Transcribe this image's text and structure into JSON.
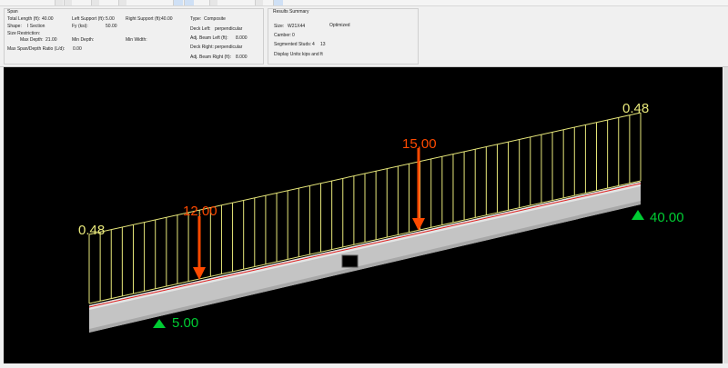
{
  "span": {
    "title": "Span",
    "total_length_label": "Total Length (ft):",
    "total_length": "40.00",
    "shape_label": "Shape:",
    "shape": "I Section",
    "size_restriction_label": "Size Restriction:",
    "max_depth_label": "Max Depth:",
    "max_depth": "21.00",
    "max_span_depth_label": "Max Span/Depth Ratio (L/d):",
    "max_span_depth": "0.00",
    "left_support_label": "Left Support (ft):",
    "left_support": "5.00",
    "fy_label": "Fy (ksi):",
    "fy": "50.00",
    "min_depth_label": "Min Depth:",
    "right_support_label": "Right Support (ft):",
    "right_support": "40.00",
    "min_width_label": "Min Width:",
    "type_label": "Type:",
    "type": "Composite",
    "deck_left_label": "Deck Left:",
    "deck_left": "perpendicular",
    "adj_beam_left_label": "Adj. Beam Left (ft):",
    "adj_beam_left": "8.000",
    "deck_right_label": "Deck Right:",
    "deck_right": "perpendicular",
    "adj_beam_right_label": "Adj. Beam Right (ft):",
    "adj_beam_right": "8.000"
  },
  "results": {
    "title": "Results Summary",
    "size_label": "Size:",
    "size": "W21X44",
    "status": "Optimized",
    "camber_label": "Camber:",
    "camber": "0",
    "studs_label": "Segmented Studs:",
    "studs_a": "4",
    "studs_b": "13",
    "units_label": "Display Units:",
    "units": "kips and ft"
  },
  "diagram": {
    "dist_load_left": "0.48",
    "dist_load_right": "0.48",
    "point_load_1": "12.00",
    "point_load_2": "15.00",
    "support_left": "5.00",
    "support_right": "40.00",
    "colors": {
      "load": "#e8e87a",
      "point": "#ff4a00",
      "support": "#00cc33",
      "beam": "#c4c4c4",
      "centerline": "#e02020",
      "bg": "#000000"
    }
  }
}
